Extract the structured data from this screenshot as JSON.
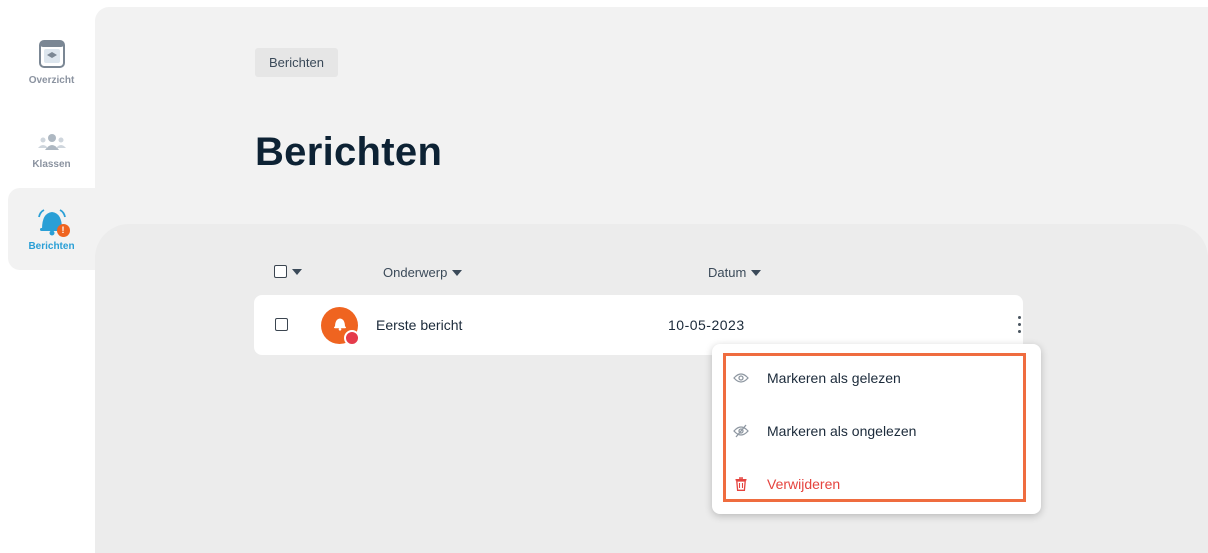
{
  "sidebar": {
    "items": [
      {
        "label": "Overzicht",
        "icon": "overview-icon"
      },
      {
        "label": "Klassen",
        "icon": "classes-icon"
      },
      {
        "label": "Berichten",
        "icon": "bell-icon",
        "badge": "!",
        "active": true
      }
    ]
  },
  "breadcrumb": {
    "label": "Berichten"
  },
  "page": {
    "title": "Berichten"
  },
  "table": {
    "columns": {
      "subject": "Onderwerp",
      "date": "Datum"
    },
    "rows": [
      {
        "subject": "Eerste bericht",
        "date": "10-05-2023",
        "unread": true
      }
    ]
  },
  "menu": {
    "items": [
      {
        "label": "Markeren als gelezen",
        "icon": "eye-icon"
      },
      {
        "label": "Markeren als ongelezen",
        "icon": "eye-off-icon"
      },
      {
        "label": "Verwijderen",
        "icon": "trash-icon"
      }
    ]
  },
  "colors": {
    "accent": "#ef6420",
    "danger": "#e5433e",
    "active_nav": "#2a9fd6",
    "highlight": "#ef6c3f"
  }
}
